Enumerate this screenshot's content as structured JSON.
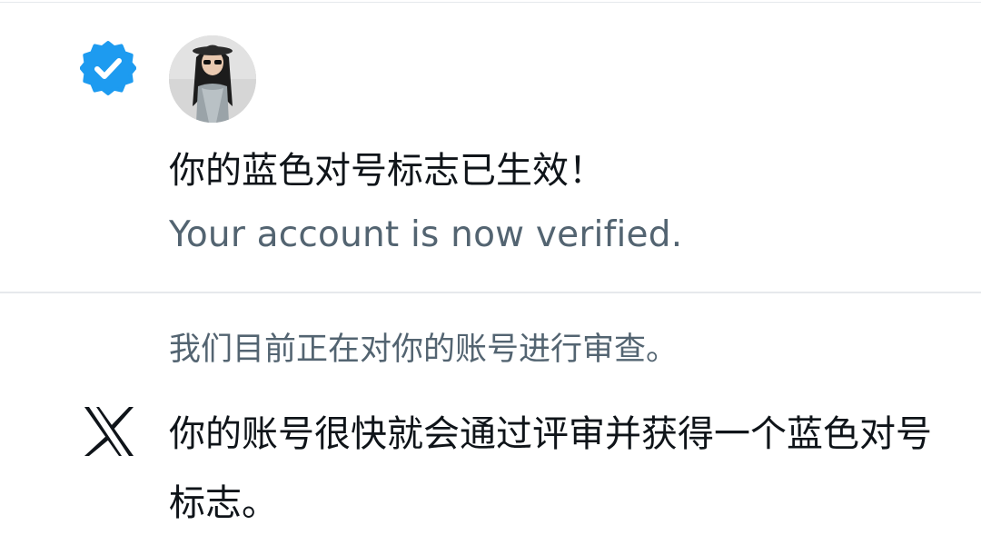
{
  "verified_notification": {
    "icon": "verified-badge-icon",
    "title": "你的蓝色对号标志已生效！",
    "subtitle": "Your account is now verified."
  },
  "review_notification": {
    "icon": "x-logo-icon",
    "status": "我们目前正在对你的账号进行审查。",
    "message": "你的账号很快就会通过评审并获得一个蓝色对号标志。"
  },
  "colors": {
    "verified_blue": "#1d9bf0",
    "primary_text": "#0f1419",
    "secondary_text": "#536471",
    "divider": "#e6e9ec"
  }
}
